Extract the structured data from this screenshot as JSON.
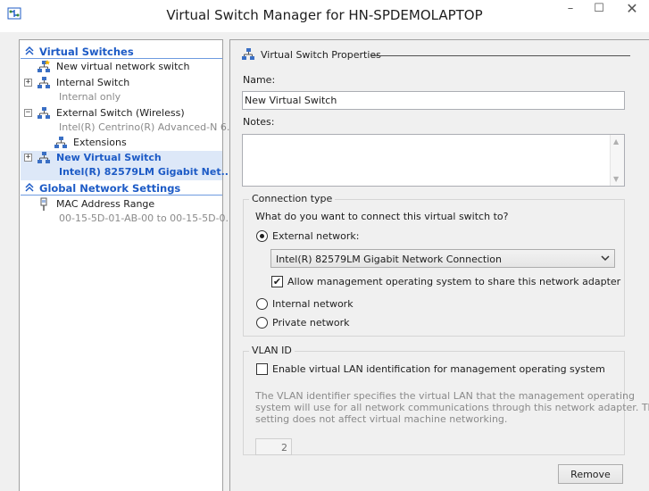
{
  "window": {
    "title": "Virtual Switch Manager for HN-SPDEMOLAPTOP",
    "controls": {
      "minimize": "–",
      "maximize": "☐",
      "close": "✕"
    }
  },
  "left_pane": {
    "sections": [
      {
        "label": "Virtual Switches",
        "items": [
          {
            "label": "New virtual network switch",
            "icon": "new-switch-icon"
          },
          {
            "label": "Internal Switch",
            "sub": "Internal only",
            "expander": "+"
          },
          {
            "label": "External Switch (Wireless)",
            "sub": "Intel(R) Centrino(R) Advanced-N 6...",
            "expander": "−"
          },
          {
            "label": "Extensions",
            "icon": "extensions-icon"
          },
          {
            "label": "New Virtual Switch",
            "sub": "Intel(R) 82579LM Gigabit Net...",
            "expander": "+",
            "selected": true
          }
        ]
      },
      {
        "label": "Global Network Settings",
        "items": [
          {
            "label": "MAC Address Range",
            "sub": "00-15-5D-01-AB-00 to 00-15-5D-0..."
          }
        ]
      }
    ]
  },
  "properties": {
    "title": "Virtual Switch Properties",
    "name_label": "Name:",
    "name_value": "New Virtual Switch",
    "notes_label": "Notes:",
    "notes_value": "",
    "connection": {
      "title": "Connection type",
      "question": "What do you want to connect this virtual switch to?",
      "external_label": "External network:",
      "external_selected": true,
      "adapter_value": "Intel(R) 82579LM Gigabit Network Connection",
      "allow_mgmt_label": "Allow management operating system to share this network adapter",
      "allow_mgmt_checked": true,
      "internal_label": "Internal network",
      "private_label": "Private network"
    },
    "vlan": {
      "title": "VLAN ID",
      "enable_label": "Enable virtual LAN identification for management operating system",
      "enable_checked": false,
      "description": "The VLAN identifier specifies the virtual LAN that the management operating system will use for all network communications through this network adapter. This setting does not affect virtual machine networking.",
      "desc_line1": "The VLAN identifier specifies the virtual LAN that the management operating",
      "desc_line2": "system will use for all network communications through this network adapter. This",
      "desc_line3": "setting does not affect virtual machine networking.",
      "id_value": "2"
    },
    "remove_label": "Remove"
  },
  "colors": {
    "section_header": "#1d5bc6",
    "selection_bg": "#dde8f8"
  }
}
